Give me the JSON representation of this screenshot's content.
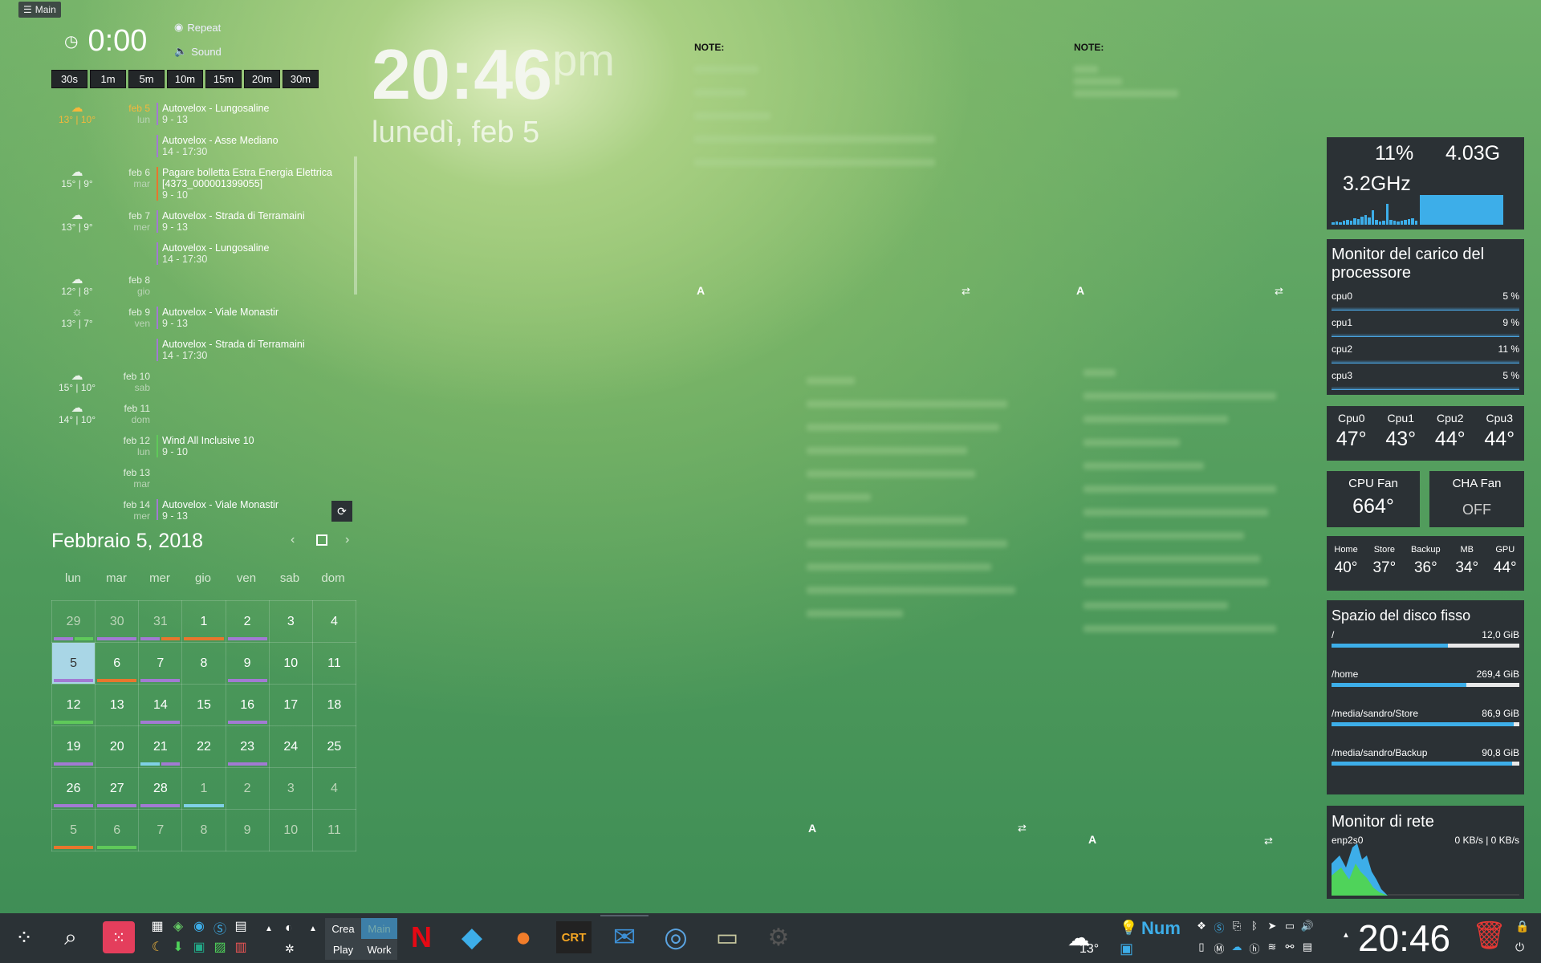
{
  "topbtn": {
    "label": "Main"
  },
  "timer": {
    "time": "0:00",
    "repeat": "Repeat",
    "sound": "Sound",
    "presets": [
      "30s",
      "1m",
      "5m",
      "10m",
      "15m",
      "20m",
      "30m"
    ]
  },
  "clock": {
    "time": "20:46",
    "ampm": "pm",
    "date": "lunedì, feb 5"
  },
  "agenda": [
    {
      "temp": "13° | 10°",
      "date": "feb 5",
      "wd": "lun",
      "today": true,
      "events": [
        {
          "title": "Autovelox - Lungosaline",
          "time": "9 - 13",
          "color": "#a27ad3"
        },
        {
          "title": "Autovelox - Asse Mediano",
          "time": "14 - 17:30",
          "color": "#a27ad3"
        }
      ]
    },
    {
      "temp": "15° | 9°",
      "date": "feb 6",
      "wd": "mar",
      "events": [
        {
          "title": "Pagare bolletta Estra Energia Elettrica [4373_000001399055]",
          "time": "9 - 10",
          "color": "#e8762d"
        }
      ]
    },
    {
      "temp": "13° | 9°",
      "date": "feb 7",
      "wd": "mer",
      "events": [
        {
          "title": "Autovelox - Strada di Terramaini",
          "time": "9 - 13",
          "color": "#a27ad3"
        },
        {
          "title": "Autovelox - Lungosaline",
          "time": "14 - 17:30",
          "color": "#a27ad3"
        }
      ]
    },
    {
      "temp": "12° | 8°",
      "date": "feb 8",
      "wd": "gio",
      "events": []
    },
    {
      "temp": "13° | 7°",
      "date": "feb 9",
      "wd": "ven",
      "events": [
        {
          "title": "Autovelox - Viale Monastir",
          "time": "9 - 13",
          "color": "#a27ad3"
        },
        {
          "title": "Autovelox - Strada di Terramaini",
          "time": "14 - 17:30",
          "color": "#a27ad3"
        }
      ]
    },
    {
      "temp": "15° | 10°",
      "date": "feb 10",
      "wd": "sab",
      "events": []
    },
    {
      "temp": "14° | 10°",
      "date": "feb 11",
      "wd": "dom",
      "events": []
    },
    {
      "temp": "",
      "date": "feb 12",
      "wd": "lun",
      "events": [
        {
          "title": "Wind All Inclusive 10",
          "time": "9 - 10",
          "color": "#5fc95a"
        }
      ]
    },
    {
      "temp": "",
      "date": "feb 13",
      "wd": "mar",
      "events": []
    },
    {
      "temp": "",
      "date": "feb 14",
      "wd": "mer",
      "events": [
        {
          "title": "Autovelox - Viale Monastir",
          "time": "9 - 13",
          "color": "#a27ad3"
        }
      ]
    }
  ],
  "calendar": {
    "title": "Febbraio 5, 2018",
    "dow": [
      "lun",
      "mar",
      "mer",
      "gio",
      "ven",
      "sab",
      "dom"
    ],
    "weeks": [
      [
        {
          "d": "29",
          "o": true,
          "b": [
            "#a27ad3",
            "#5fc95a"
          ]
        },
        {
          "d": "30",
          "o": true,
          "b": [
            "#a27ad3"
          ]
        },
        {
          "d": "31",
          "o": true,
          "b": [
            "#a27ad3",
            "#e8762d"
          ]
        },
        {
          "d": "1",
          "b": [
            "#e8762d"
          ]
        },
        {
          "d": "2",
          "b": [
            "#a27ad3"
          ]
        },
        {
          "d": "3"
        },
        {
          "d": "4"
        }
      ],
      [
        {
          "d": "5",
          "sel": true,
          "b": [
            "#a27ad3"
          ]
        },
        {
          "d": "6",
          "b": [
            "#e8762d"
          ]
        },
        {
          "d": "7",
          "b": [
            "#a27ad3"
          ]
        },
        {
          "d": "8"
        },
        {
          "d": "9",
          "b": [
            "#a27ad3"
          ]
        },
        {
          "d": "10"
        },
        {
          "d": "11"
        }
      ],
      [
        {
          "d": "12",
          "b": [
            "#5fc95a"
          ]
        },
        {
          "d": "13"
        },
        {
          "d": "14",
          "b": [
            "#a27ad3"
          ]
        },
        {
          "d": "15"
        },
        {
          "d": "16",
          "b": [
            "#a27ad3"
          ]
        },
        {
          "d": "17"
        },
        {
          "d": "18"
        }
      ],
      [
        {
          "d": "19",
          "b": [
            "#a27ad3"
          ]
        },
        {
          "d": "20"
        },
        {
          "d": "21",
          "b": [
            "#7fd0e6",
            "#a27ad3"
          ]
        },
        {
          "d": "22"
        },
        {
          "d": "23",
          "b": [
            "#a27ad3"
          ]
        },
        {
          "d": "24"
        },
        {
          "d": "25"
        }
      ],
      [
        {
          "d": "26",
          "b": [
            "#a27ad3"
          ]
        },
        {
          "d": "27",
          "b": [
            "#a27ad3"
          ]
        },
        {
          "d": "28",
          "b": [
            "#a27ad3"
          ]
        },
        {
          "d": "1",
          "o": true,
          "b": [
            "#7fd0e6"
          ]
        },
        {
          "d": "2",
          "o": true
        },
        {
          "d": "3",
          "o": true
        },
        {
          "d": "4",
          "o": true
        }
      ],
      [
        {
          "d": "5",
          "o": true,
          "b": [
            "#e8762d"
          ]
        },
        {
          "d": "6",
          "o": true,
          "b": [
            "#5fc95a"
          ]
        },
        {
          "d": "7",
          "o": true
        },
        {
          "d": "8",
          "o": true
        },
        {
          "d": "9",
          "o": true
        },
        {
          "d": "10",
          "o": true
        },
        {
          "d": "11",
          "o": true
        }
      ]
    ]
  },
  "notes": {
    "label1": "NOTE:",
    "label2": "NOTE:",
    "a": "A"
  },
  "sys": {
    "cpu_pct": "11%",
    "mem": "4.03G",
    "freq": "3.2GHz",
    "cpu_title": "Monitor del carico del processore",
    "cpus": [
      {
        "n": "cpu0",
        "v": "5 %"
      },
      {
        "n": "cpu1",
        "v": "9 %"
      },
      {
        "n": "cpu2",
        "v": "11 %"
      },
      {
        "n": "cpu3",
        "v": "5 %"
      }
    ],
    "temps": [
      {
        "n": "Cpu0",
        "v": "47°"
      },
      {
        "n": "Cpu1",
        "v": "43°"
      },
      {
        "n": "Cpu2",
        "v": "44°"
      },
      {
        "n": "Cpu3",
        "v": "44°"
      }
    ],
    "fan1": {
      "n": "CPU Fan",
      "v": "664°"
    },
    "fan2": {
      "n": "CHA Fan",
      "v": "OFF"
    },
    "disks_t": [
      {
        "n": "Home",
        "v": "40°"
      },
      {
        "n": "Store",
        "v": "37°"
      },
      {
        "n": "Backup",
        "v": "36°"
      },
      {
        "n": "MB",
        "v": "34°"
      },
      {
        "n": "GPU",
        "v": "44°"
      }
    ],
    "disk_title": "Spazio del disco fisso",
    "disks": [
      {
        "n": "/",
        "v": "12,0 GiB",
        "f": 0.62
      },
      {
        "n": "/home",
        "v": "269,4 GiB",
        "f": 0.72
      },
      {
        "n": "/media/sandro/Store",
        "v": "86,9 GiB",
        "f": 0.97
      },
      {
        "n": "/media/sandro/Backup",
        "v": "90,8 GiB",
        "f": 0.96
      }
    ],
    "net_title": "Monitor di rete",
    "net_if": "enp2s0",
    "net_v": "0 KB/s | 0 KB/s"
  },
  "taskbar": {
    "crea": "Crea",
    "main": "Main",
    "play": "Play",
    "work": "Work",
    "num": "Num",
    "clock": "20:46",
    "weather": "13°",
    "colors": {
      "accent": "#3daee9",
      "netflix": "#e50914"
    }
  }
}
